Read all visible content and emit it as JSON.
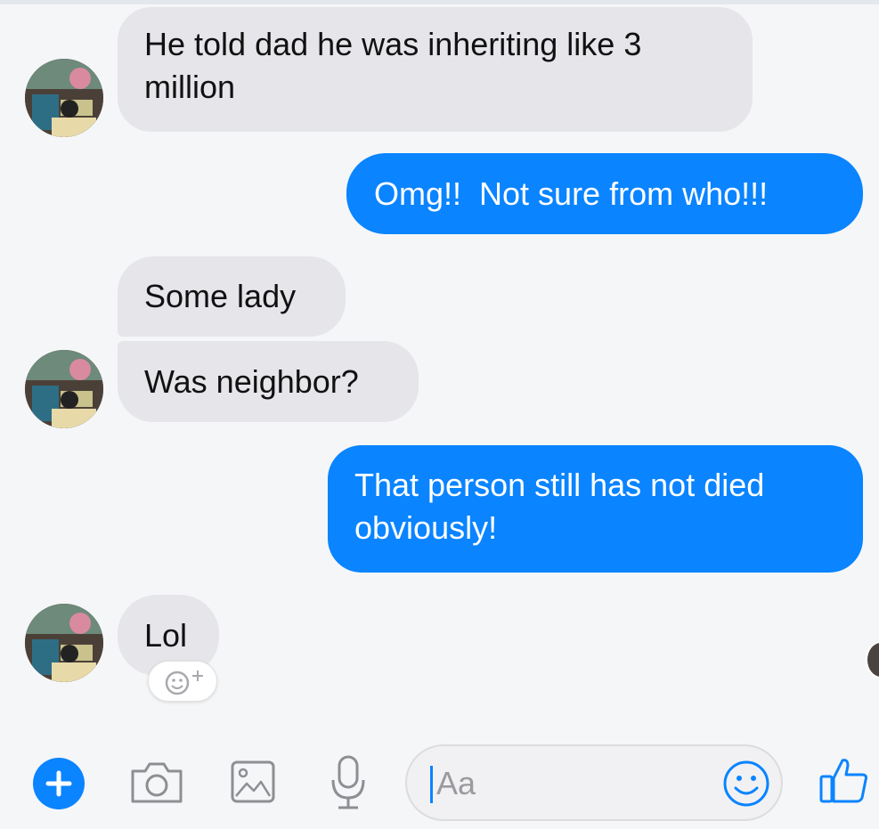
{
  "conversation": {
    "messages": [
      {
        "direction": "incoming",
        "text": "He told dad he was inheriting like 3 million"
      },
      {
        "direction": "outgoing",
        "text": "Omg!!  Not sure from who!!!"
      },
      {
        "direction": "incoming",
        "text": "Some lady"
      },
      {
        "direction": "incoming",
        "text": "Was neighbor?"
      },
      {
        "direction": "outgoing",
        "text": "That person still has not died obviously!"
      },
      {
        "direction": "incoming",
        "text": "Lol"
      }
    ]
  },
  "composer": {
    "placeholder": "Aa",
    "icons": [
      "plus-icon",
      "camera-icon",
      "photo-icon",
      "microphone-icon",
      "emoji-icon",
      "like-icon"
    ]
  },
  "colors": {
    "accent": "#0a84ff",
    "incoming_bubble": "#e5e5ea",
    "background": "#f5f6f8"
  }
}
